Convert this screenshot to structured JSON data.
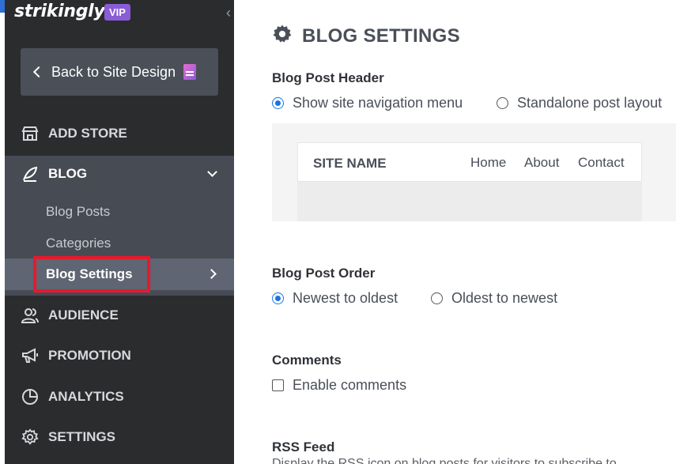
{
  "sidebar": {
    "logo": "strikingly",
    "badge": "VIP",
    "back_button": "Back to Site Design",
    "nav": {
      "add_store": "ADD STORE",
      "blog": "BLOG",
      "audience": "AUDIENCE",
      "promotion": "PROMOTION",
      "analytics": "ANALYTICS",
      "settings": "SETTINGS"
    },
    "blog_sub": {
      "posts": "Blog Posts",
      "categories": "Categories",
      "settings": "Blog Settings"
    }
  },
  "main": {
    "title": "BLOG SETTINGS",
    "header_section": {
      "title": "Blog Post Header",
      "option1": "Show site navigation menu",
      "option2": "Standalone post layout",
      "selected": "option1"
    },
    "preview": {
      "site_name": "SITE NAME",
      "links": [
        "Home",
        "About",
        "Contact"
      ]
    },
    "order_section": {
      "title": "Blog Post Order",
      "option1": "Newest to oldest",
      "option2": "Oldest to newest",
      "selected": "option1"
    },
    "comments_section": {
      "title": "Comments",
      "checkbox_label": "Enable comments",
      "checked": false
    },
    "rss_section": {
      "title": "RSS Feed",
      "description": "Display the RSS icon on blog posts for visitors to subscribe to"
    }
  },
  "colors": {
    "sidebar_bg": "#2b2c2e",
    "accent": "#1a73e8",
    "highlight": "#e8192c",
    "vip": "#8a5cd6"
  }
}
